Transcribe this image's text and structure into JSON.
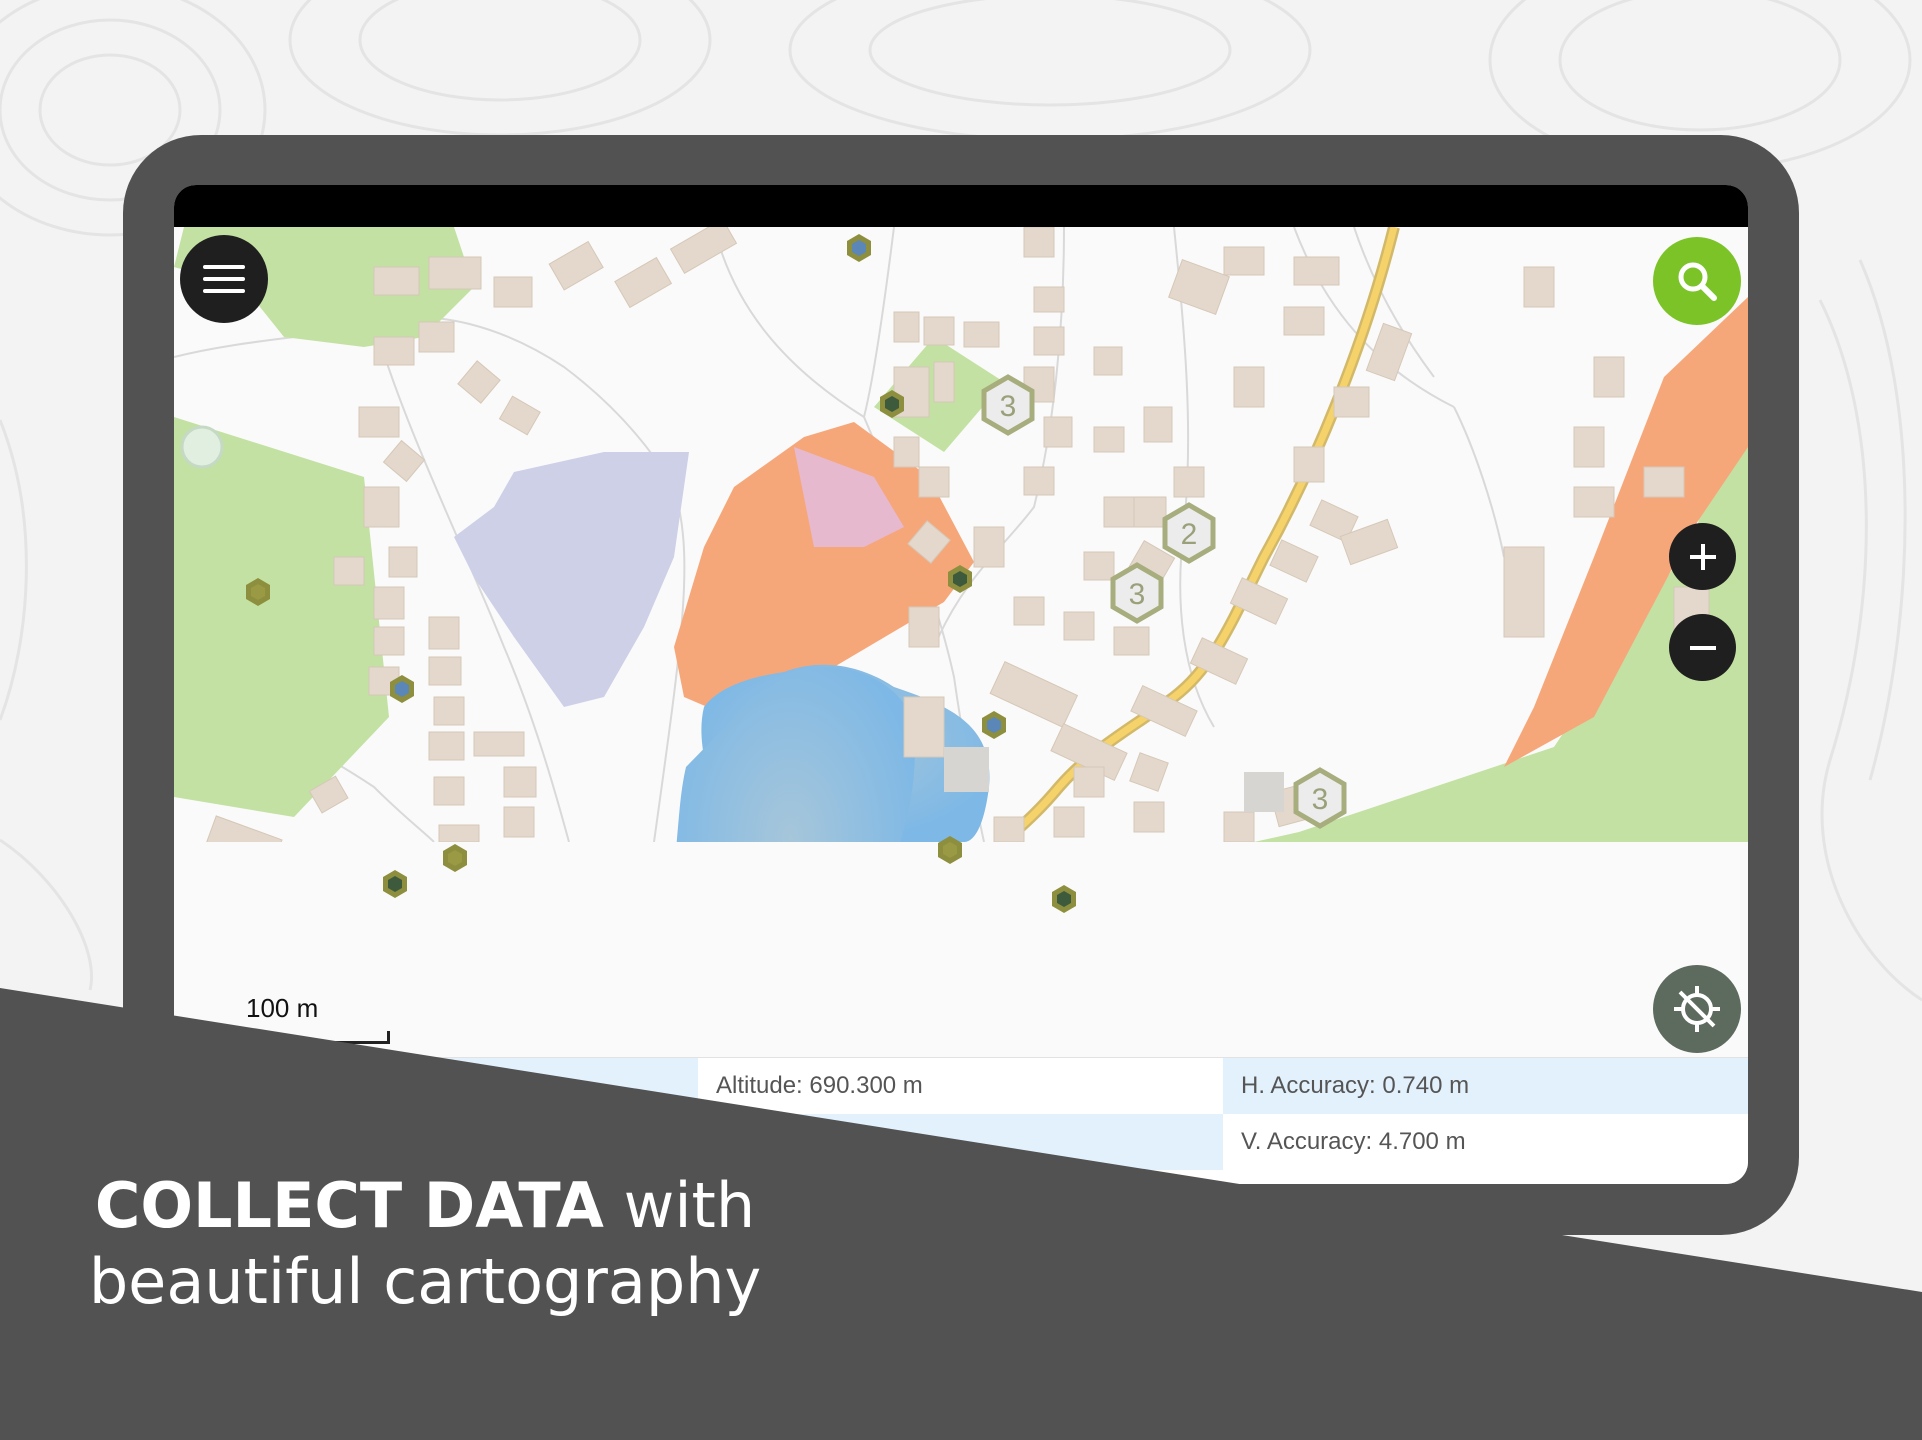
{
  "map": {
    "scale_label": "100 m",
    "cluster_counts": [
      "3",
      "2",
      "3",
      "3"
    ],
    "colors": {
      "water": "#7db8e6",
      "park": "#c3e1a2",
      "orange_zone": "#f6a77a",
      "purple_zone": "#cdd0e6",
      "building": "#e3d8cb",
      "road_main": "#f5d26a",
      "marker_dark": "#3d5a3d",
      "marker_olive": "#8d8f3e",
      "marker_blue": "#5a86b8"
    }
  },
  "controls": {
    "menu_icon": "hamburger-menu-icon",
    "search_icon": "search-icon",
    "zoom_in_icon": "plus-icon",
    "zoom_out_icon": "minus-icon",
    "gps_icon": "gps-off-icon",
    "search_color": "#7cc328"
  },
  "info_panel": {
    "altitude": "Altitude: 690.300 m",
    "h_accuracy": "H. Accuracy: 0.740 m",
    "v_accuracy": "V. Accuracy: 4.700 m"
  },
  "promo": {
    "headline_bold": "COLLECT DATA",
    "headline_rest": " with",
    "headline_line2": "beautiful cartography"
  }
}
